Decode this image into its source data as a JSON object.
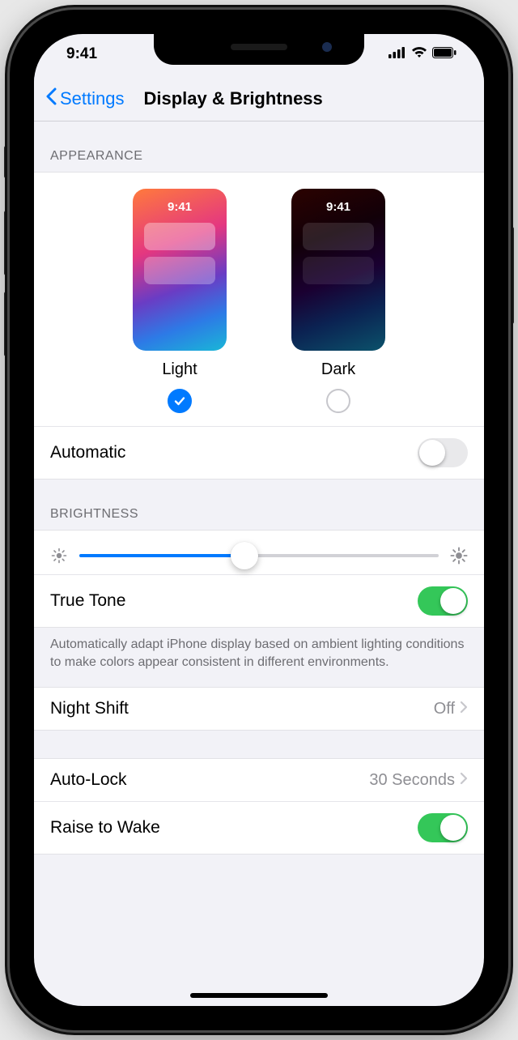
{
  "status": {
    "time": "9:41"
  },
  "nav": {
    "back": "Settings",
    "title": "Display & Brightness"
  },
  "appearance": {
    "header": "APPEARANCE",
    "preview_time": "9:41",
    "light_label": "Light",
    "dark_label": "Dark",
    "selected": "light",
    "automatic_label": "Automatic",
    "automatic_on": false
  },
  "brightness": {
    "header": "BRIGHTNESS",
    "value_percent": 46,
    "true_tone_label": "True Tone",
    "true_tone_on": true,
    "true_tone_footer": "Automatically adapt iPhone display based on ambient lighting conditions to make colors appear consistent in different environments."
  },
  "night_shift": {
    "label": "Night Shift",
    "value": "Off"
  },
  "auto_lock": {
    "label": "Auto-Lock",
    "value": "30 Seconds"
  },
  "raise_to_wake": {
    "label": "Raise to Wake",
    "on": true
  }
}
